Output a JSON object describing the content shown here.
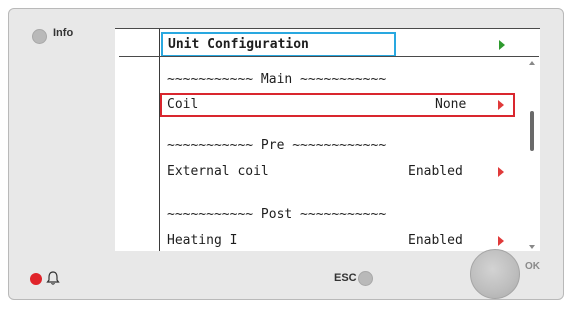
{
  "device": {
    "info_label": "Info",
    "esc_label": "ESC",
    "ok_label": "OK",
    "alarm_led_color": "#e0242a",
    "info_led_color": "#b9b9b9",
    "esc_led_color": "#b9b9b9",
    "bell_icon": "bell-icon"
  },
  "screen": {
    "title": "Unit Configuration",
    "sections": [
      {
        "header": "~~~~~~~~~~~ Main ~~~~~~~~~~~",
        "items": [
          {
            "label": "Coil",
            "value": "None",
            "selected": true
          }
        ]
      },
      {
        "header": "~~~~~~~~~~~ Pre ~~~~~~~~~~~~",
        "items": [
          {
            "label": "External coil",
            "value": "Enabled",
            "selected": false
          }
        ]
      },
      {
        "header": "~~~~~~~~~~~ Post ~~~~~~~~~~~",
        "items": [
          {
            "label": "Heating I",
            "value": "Enabled",
            "selected": false
          }
        ]
      }
    ],
    "scroll_position": 0.3
  }
}
